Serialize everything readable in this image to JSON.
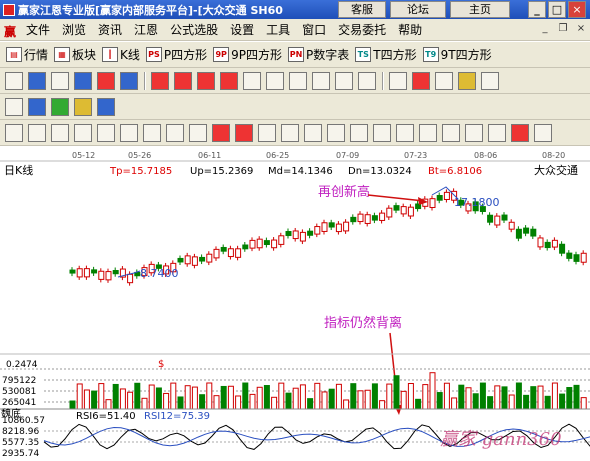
{
  "titlebar": {
    "title": "赢家江恩专业版[赢家内部服务平台]-[大众交通 SH60",
    "tabs": [
      "客服",
      "论坛",
      "主页"
    ]
  },
  "menu": {
    "items": [
      "文件",
      "浏览",
      "资讯",
      "江恩",
      "公式选股",
      "设置",
      "工具",
      "窗口",
      "交易委托",
      "帮助"
    ]
  },
  "toolbar": {
    "items": [
      {
        "label": "行情",
        "icon": "quote-icon"
      },
      {
        "label": "板块",
        "icon": "sector-icon"
      },
      {
        "label": "K线",
        "icon": "kline-icon"
      },
      {
        "label": "P四方形",
        "icon": "p-square-icon"
      },
      {
        "label": "9P四方形",
        "icon": "9p-square-icon"
      },
      {
        "label": "P数字表",
        "icon": "p-number-table-icon"
      },
      {
        "label": "T四方形",
        "icon": "t-square-icon"
      },
      {
        "label": "9T四方形",
        "icon": "9t-square-icon"
      }
    ]
  },
  "chart_data": {
    "type": "candlestick",
    "panel_label": "日K线",
    "stock_name": "大众交通",
    "date_ticks": [
      "05-12",
      "05-26",
      "06-11",
      "06-25",
      "07-09",
      "07-23",
      "08-06",
      "08-20"
    ],
    "stats": {
      "tp": "Tp=15.7185",
      "up": "Up=15.2369",
      "md": "Md=14.1346",
      "dn": "Dn=13.0324",
      "bt": "Bt=6.8106"
    },
    "labels": {
      "low": "8.7400",
      "high": "17.1800",
      "annotation_top": "再创新高",
      "annotation_bottom": "指标仍然背离"
    },
    "volume": {
      "axis": [
        "0.2474",
        "795122",
        "530081",
        "265041"
      ]
    },
    "rsi": {
      "panel_name": "魏底",
      "rsi6": "RSI6=51.40",
      "rsi12": "RSI12=75.39",
      "axis": [
        "10860.57",
        "8218.96",
        "5577.35",
        "2935.74"
      ]
    },
    "watermark": "赢家 gann360"
  }
}
